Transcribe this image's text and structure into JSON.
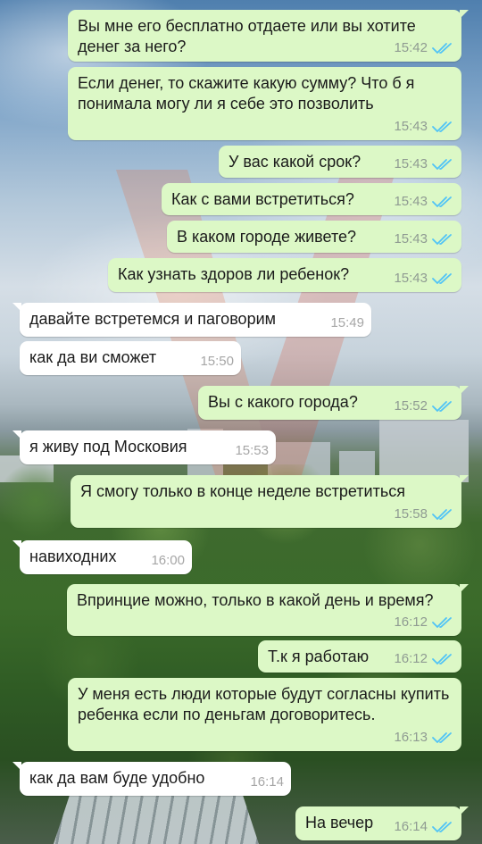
{
  "colors": {
    "outgoing_bubble": "#dcf8c6",
    "incoming_bubble": "#ffffff",
    "read_ticks": "#4fc3f7",
    "time_text": "#8f9b92"
  },
  "icons": {
    "read_status": "double-check-icon"
  },
  "messages": [
    {
      "direction": "out",
      "text": "Вы мне его бесплатно отдаете или вы хотите денег за него?",
      "time": "15:42",
      "read": true
    },
    {
      "direction": "out",
      "text": "Если денег, то скажите какую сумму? Что б я понимала могу ли я себе это позволить",
      "time": "15:43",
      "read": true
    },
    {
      "direction": "out",
      "text": "У вас какой срок?",
      "time": "15:43",
      "read": true
    },
    {
      "direction": "out",
      "text": "Как с вами встретиться?",
      "time": "15:43",
      "read": true
    },
    {
      "direction": "out",
      "text": "В каком городе живете?",
      "time": "15:43",
      "read": true
    },
    {
      "direction": "out",
      "text": "Как узнать здоров ли ребенок?",
      "time": "15:43",
      "read": true
    },
    {
      "direction": "in",
      "text": "давайте встретемся и паговорим",
      "time": "15:49"
    },
    {
      "direction": "in",
      "text": "как да ви сможет",
      "time": "15:50"
    },
    {
      "direction": "out",
      "text": "Вы с какого города?",
      "time": "15:52",
      "read": true
    },
    {
      "direction": "in",
      "text": "я живу под Московия",
      "time": "15:53"
    },
    {
      "direction": "out",
      "text": "Я смогу только в конце неделе встретиться",
      "time": "15:58",
      "read": true
    },
    {
      "direction": "in",
      "text": "навиходних",
      "time": "16:00"
    },
    {
      "direction": "out",
      "text": "Впринцие можно, только в какой день и время?",
      "time": "16:12",
      "read": true
    },
    {
      "direction": "out",
      "text": "Т.к я работаю",
      "time": "16:12",
      "read": true
    },
    {
      "direction": "out",
      "text": "У меня есть люди которые будут согласны купить ребенка если по деньгам договоритесь.",
      "time": "16:13",
      "read": true
    },
    {
      "direction": "in",
      "text": "как да вам буде удобно",
      "time": "16:14"
    },
    {
      "direction": "out",
      "text": "На вечер",
      "time": "16:14",
      "read": true
    }
  ]
}
